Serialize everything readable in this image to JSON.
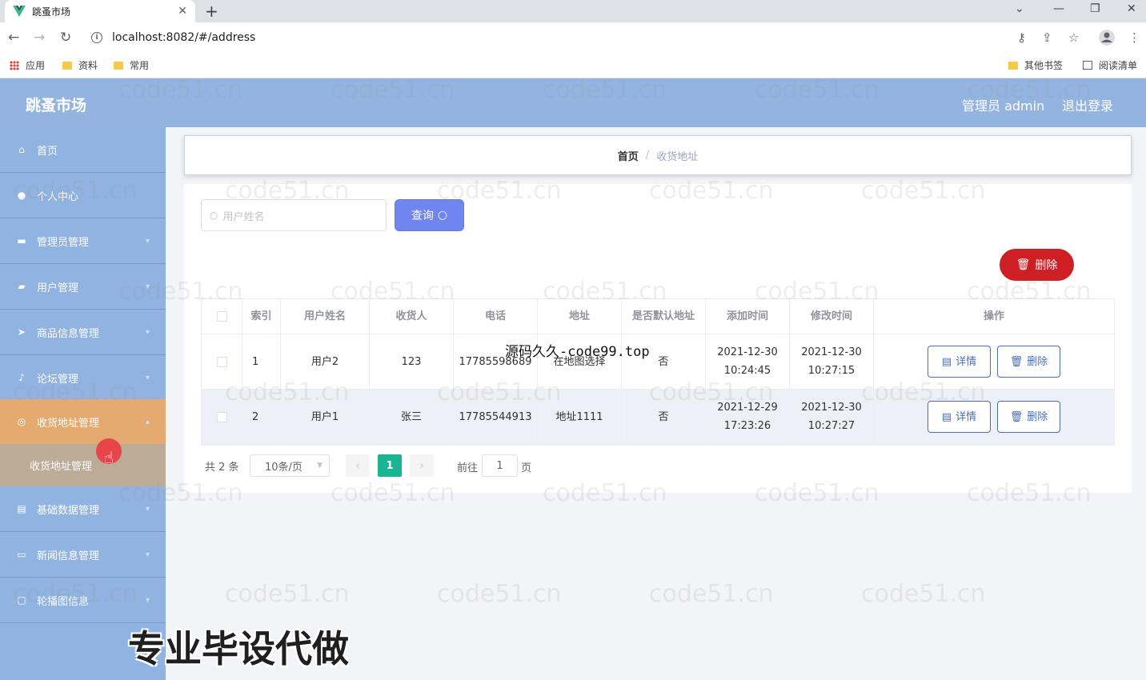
{
  "browser": {
    "tab_title": "跳蚤市场",
    "url": "localhost:8082/#/address",
    "bookmarks": {
      "apps": "应用",
      "folder1": "资料",
      "folder2": "常用",
      "other": "其他书签",
      "reading": "阅读清单"
    }
  },
  "header": {
    "brand": "跳蚤市场",
    "user": "管理员 admin",
    "logout": "退出登录"
  },
  "sidebar": {
    "items": [
      {
        "label": "首页",
        "icon": "home-icon"
      },
      {
        "label": "个人中心",
        "icon": "user-icon"
      },
      {
        "label": "管理员管理",
        "icon": "admin-icon"
      },
      {
        "label": "用户管理",
        "icon": "users-icon"
      },
      {
        "label": "商品信息管理",
        "icon": "send-icon"
      },
      {
        "label": "论坛管理",
        "icon": "mic-icon"
      },
      {
        "label": "收货地址管理",
        "icon": "check-circle-icon"
      },
      {
        "label": "基础数据管理",
        "icon": "document-icon"
      },
      {
        "label": "新闻信息管理",
        "icon": "chat-icon"
      },
      {
        "label": "轮播图信息",
        "icon": "image-icon"
      }
    ],
    "sub_item": "收货地址管理"
  },
  "breadcrumb": {
    "home": "首页",
    "separator": "/",
    "current": "收货地址"
  },
  "search": {
    "placeholder": "用户姓名",
    "query_label": "查询"
  },
  "batch_delete_label": "删除",
  "table": {
    "headers": [
      "索引",
      "用户姓名",
      "收货人",
      "电话",
      "地址",
      "是否默认地址",
      "添加时间",
      "修改时间",
      "操作"
    ],
    "rows": [
      {
        "index": "1",
        "username": "用户2",
        "receiver": "123",
        "phone": "17785598689",
        "address": "在地图选择",
        "default": "否",
        "created": "2021-12-30 10:24:45",
        "modified": "2021-12-30 10:27:15"
      },
      {
        "index": "2",
        "username": "用户1",
        "receiver": "张三",
        "phone": "17785544913",
        "address": "地址1111",
        "default": "否",
        "created": "2021-12-29 17:23:26",
        "modified": "2021-12-30 10:27:27"
      }
    ],
    "detail_label": "详情",
    "delete_label": "删除"
  },
  "pagination": {
    "total": "共 2 条",
    "page_size": "10条/页",
    "current_page": "1",
    "goto_prefix": "前往",
    "goto_value": "1",
    "goto_suffix": "页"
  },
  "watermark": "code51.cn",
  "overlays": {
    "site": "源码久久-code99.top",
    "banner": "专业毕设代做"
  }
}
